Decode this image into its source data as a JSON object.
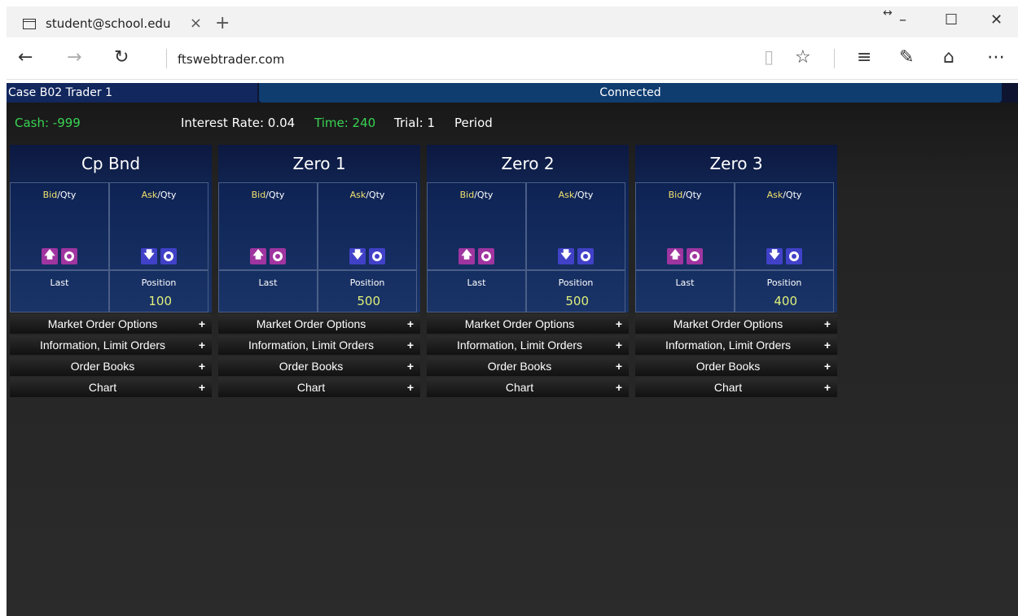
{
  "browser": {
    "tab_title": "student@school.edu",
    "tab_close": "×",
    "new_tab": "+",
    "url": "ftswebtrader.com"
  },
  "app": {
    "trader": "Case B02 Trader 1",
    "connection": "Connected",
    "cash": "Cash: -999",
    "interest_rate": "Interest Rate: 0.04",
    "time": "Time: 240",
    "trial": "Trial: 1",
    "period": "Period"
  },
  "labels": {
    "bid": "Bid",
    "qty_suffix": "/Qty",
    "ask": "Ask",
    "last": "Last",
    "position": "Position",
    "market_order_options": "Market Order Options",
    "information_limit_orders": "Information, Limit Orders",
    "order_books": "Order Books",
    "chart": "Chart",
    "plus": "+"
  },
  "securities": [
    {
      "name": "Cp Bnd",
      "position": "100"
    },
    {
      "name": "Zero 1",
      "position": "500"
    },
    {
      "name": "Zero 2",
      "position": "500"
    },
    {
      "name": "Zero 3",
      "position": "400"
    }
  ],
  "colors": {
    "accent_green": "#39d353",
    "buy_purple": "#a035a0",
    "sell_blue": "#4141c8",
    "position_yellow": "#dff07a"
  },
  "icons": {
    "buy": "up-arrow-icon",
    "sell": "down-arrow-icon",
    "cancel": "target-icon"
  }
}
